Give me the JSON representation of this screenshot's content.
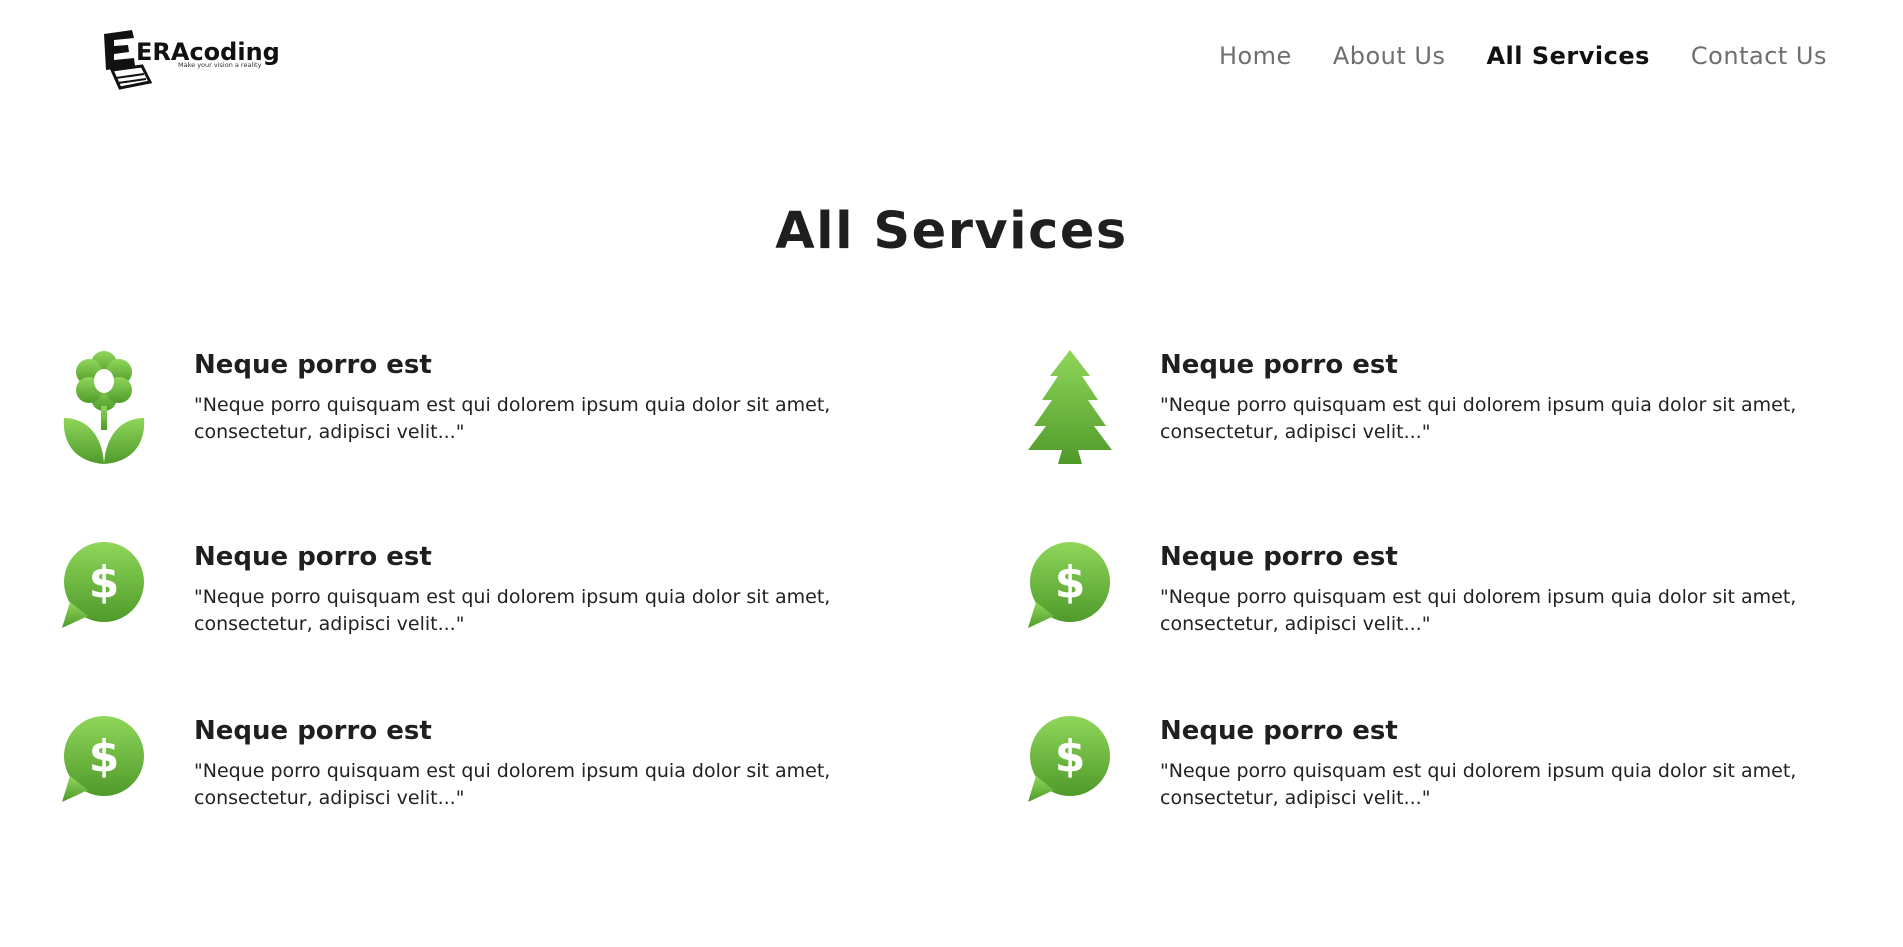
{
  "logo": {
    "brand_text": "ERAcoding",
    "tagline": "Make your vision a reality"
  },
  "nav": {
    "items": [
      {
        "label": "Home"
      },
      {
        "label": "About Us"
      },
      {
        "label": "All Services"
      },
      {
        "label": "Contact Us"
      }
    ],
    "active": "All Services"
  },
  "page": {
    "title": "All Services"
  },
  "services": [
    {
      "icon": "flower-icon",
      "title": "Neque porro est",
      "description": "\"Neque porro quisquam est qui dolorem ipsum quia dolor sit amet, consectetur, adipisci velit...\""
    },
    {
      "icon": "tree-icon",
      "title": "Neque porro est",
      "description": "\"Neque porro quisquam est qui dolorem ipsum quia dolor sit amet, consectetur, adipisci velit...\""
    },
    {
      "icon": "dollar-chat-icon",
      "title": "Neque porro est",
      "description": "\"Neque porro quisquam est qui dolorem ipsum quia dolor sit amet, consectetur, adipisci velit...\""
    },
    {
      "icon": "dollar-chat-icon",
      "title": "Neque porro est",
      "description": "\"Neque porro quisquam est qui dolorem ipsum quia dolor sit amet, consectetur, adipisci velit...\""
    },
    {
      "icon": "dollar-chat-icon",
      "title": "Neque porro est",
      "description": "\"Neque porro quisquam est qui dolorem ipsum quia dolor sit amet, consectetur, adipisci velit...\""
    },
    {
      "icon": "dollar-chat-icon",
      "title": "Neque porro est",
      "description": "\"Neque porro quisquam est qui dolorem ipsum quia dolor sit amet, consectetur, adipisci velit...\""
    }
  ],
  "colors": {
    "icon_green_light": "#8fd65a",
    "icon_green_dark": "#4f9a2a",
    "text_dark": "#1f1f1f",
    "nav_inactive": "#6f6f6f"
  }
}
